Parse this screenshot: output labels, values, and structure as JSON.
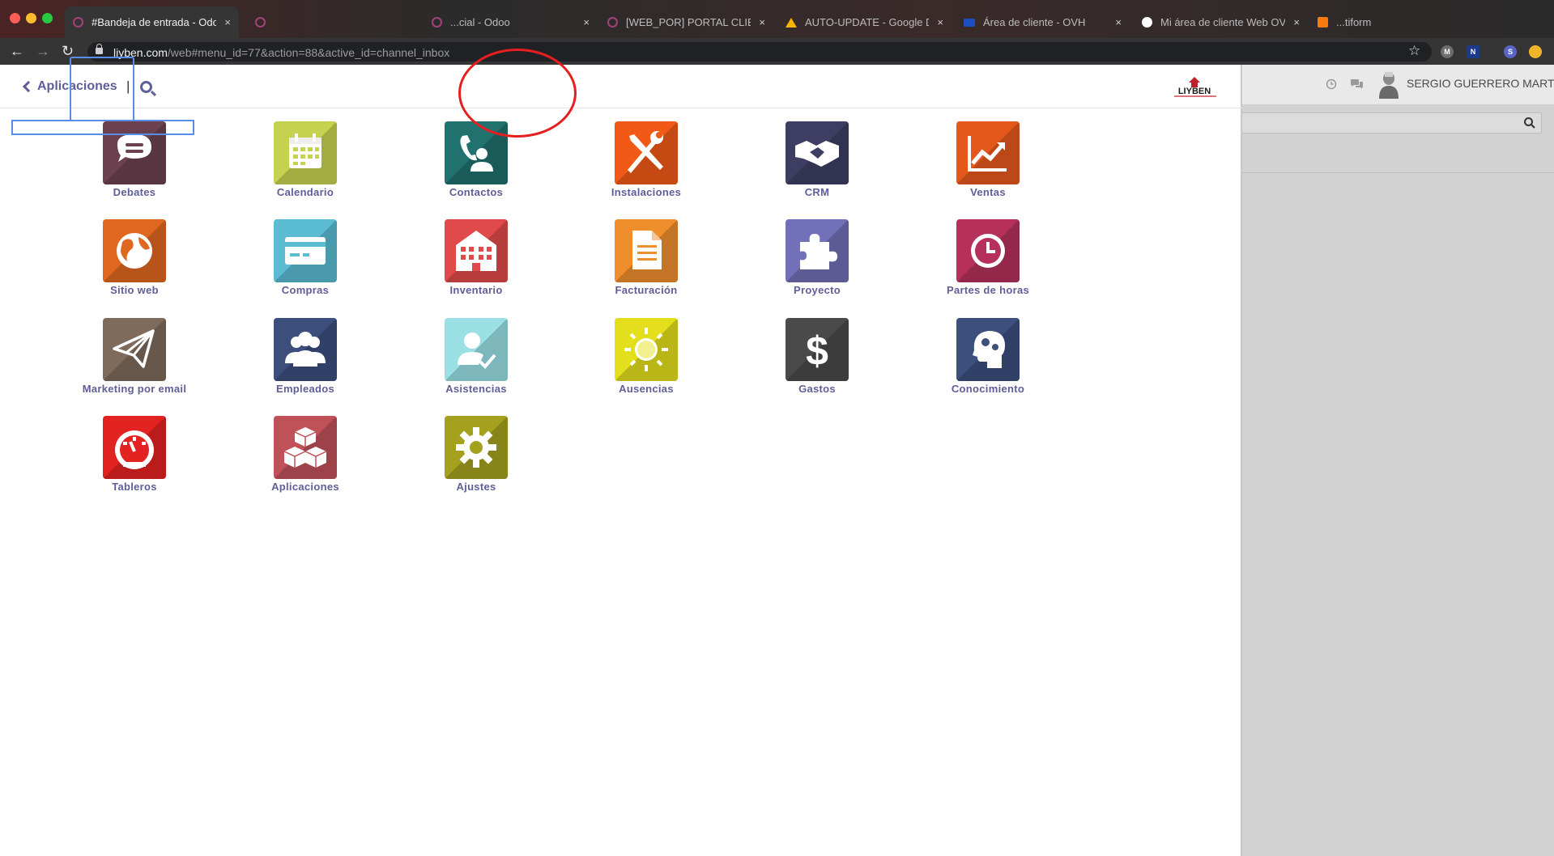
{
  "browser": {
    "tabs": [
      {
        "title": "#Bandeja de entrada - Odoo",
        "icon": "odoo-icon",
        "active": true
      },
      {
        "title": "",
        "icon": "odoo-icon"
      },
      {
        "title": "...cial - Odoo",
        "icon": "odoo-icon"
      },
      {
        "title": "[WEB_POR] PORTAL CLIEN",
        "icon": "odoo-icon"
      },
      {
        "title": "AUTO-UPDATE - Google Dri",
        "icon": "google-drive-icon"
      },
      {
        "title": "Área de cliente - OVH",
        "icon": "ovh-icon"
      },
      {
        "title": "Mi área de cliente Web OVH",
        "icon": "vw-icon"
      },
      {
        "title": "...tiform",
        "icon": "orange-app-icon"
      }
    ],
    "close_glyph": "×",
    "url_host": "liyben.com",
    "url_path": "/web#menu_id=77&action=88&active_id=channel_inbox",
    "extensions": [
      "M",
      "N",
      "S"
    ]
  },
  "topbar": {
    "back_label": "Aplicaciones",
    "separator": "|",
    "logo_text": "LIYBEN"
  },
  "background_page": {
    "user_name": "SERGIO GUERRERO MARTIN"
  },
  "apps": [
    {
      "label": "Debates",
      "icon": "chat-bubble-icon",
      "color": "#6b4150"
    },
    {
      "label": "Calendario",
      "icon": "calendar-icon",
      "color": "#c5d250"
    },
    {
      "label": "Contactos",
      "icon": "contact-phone-icon",
      "color": "#21716f"
    },
    {
      "label": "Instalaciones",
      "icon": "wrench-screwdriver-icon",
      "color": "#f05a16"
    },
    {
      "label": "CRM",
      "icon": "handshake-icon",
      "color": "#3e3e63"
    },
    {
      "label": "Ventas",
      "icon": "trend-chart-icon",
      "color": "#e4581b"
    },
    {
      "label": "Sitio web",
      "icon": "globe-icon",
      "color": "#e0671f"
    },
    {
      "label": "Compras",
      "icon": "credit-card-icon",
      "color": "#5bbcd3"
    },
    {
      "label": "Inventario",
      "icon": "warehouse-icon",
      "color": "#e04a4a"
    },
    {
      "label": "Facturación",
      "icon": "document-icon",
      "color": "#ee8e2d"
    },
    {
      "label": "Proyecto",
      "icon": "puzzle-icon",
      "color": "#7170b8"
    },
    {
      "label": "Partes de horas",
      "icon": "clock-icon",
      "color": "#b5315b"
    },
    {
      "label": "Marketing por email",
      "icon": "paper-plane-icon",
      "color": "#7f6b5c"
    },
    {
      "label": "Empleados",
      "icon": "people-icon",
      "color": "#3c4f7d"
    },
    {
      "label": "Asistencias",
      "icon": "user-check-icon",
      "color": "#9ae0e4"
    },
    {
      "label": "Ausencias",
      "icon": "sun-icon",
      "color": "#e3df1d"
    },
    {
      "label": "Gastos",
      "icon": "dollar-icon",
      "color": "#4a4a4a"
    },
    {
      "label": "Conocimiento",
      "icon": "brain-gears-icon",
      "color": "#3c4f7d"
    },
    {
      "label": "Tableros",
      "icon": "dashboard-gauge-icon",
      "color": "#e32222"
    },
    {
      "label": "Aplicaciones",
      "icon": "cubes-icon",
      "color": "#bf5158"
    },
    {
      "label": "Ajustes",
      "icon": "gear-icon",
      "color": "#a5a11f"
    }
  ]
}
